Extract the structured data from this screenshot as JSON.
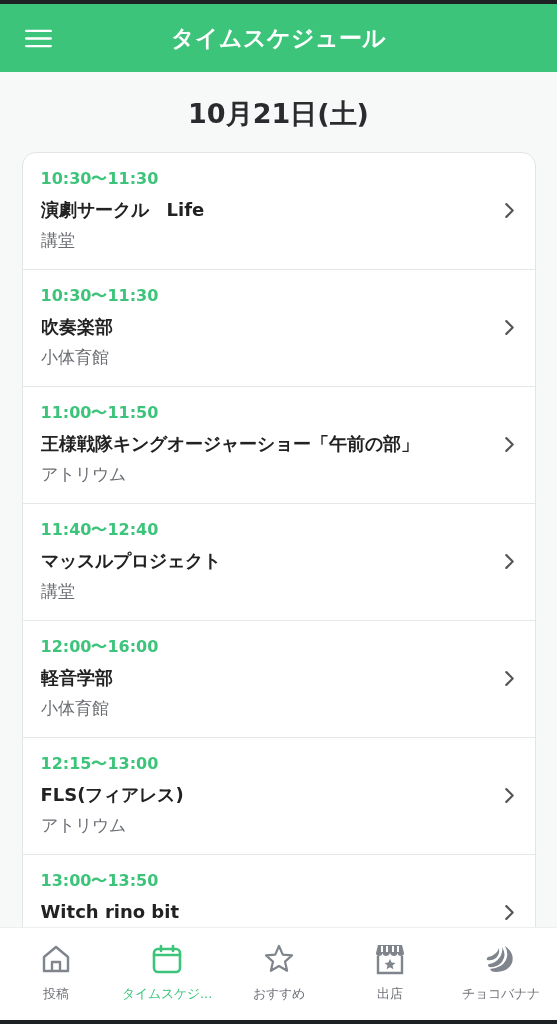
{
  "header": {
    "title": "タイムスケジュール"
  },
  "date": "10月21日(土)",
  "events": [
    {
      "time": "10:30〜11:30",
      "title": "演劇サークル　Life",
      "location": "講堂"
    },
    {
      "time": "10:30〜11:30",
      "title": "吹奏楽部",
      "location": "小体育館"
    },
    {
      "time": "11:00〜11:50",
      "title": "王様戦隊キングオージャーショー「午前の部」",
      "location": "アトリウム"
    },
    {
      "time": "11:40〜12:40",
      "title": "マッスルプロジェクト",
      "location": "講堂"
    },
    {
      "time": "12:00〜16:00",
      "title": "軽音学部",
      "location": "小体育館"
    },
    {
      "time": "12:15〜13:00",
      "title": "FLS(フィアレス)",
      "location": "アトリウム"
    },
    {
      "time": "13:00〜13:50",
      "title": "Witch rino bit"
    }
  ],
  "tabs": [
    {
      "kind": "home",
      "label": "投稿",
      "selected": false
    },
    {
      "kind": "calendar",
      "label": "タイムスケジ...",
      "selected": true
    },
    {
      "kind": "star",
      "label": "おすすめ",
      "selected": false
    },
    {
      "kind": "shop",
      "label": "出店",
      "selected": false
    },
    {
      "kind": "banana",
      "label": "チョコバナナ",
      "selected": false
    }
  ]
}
